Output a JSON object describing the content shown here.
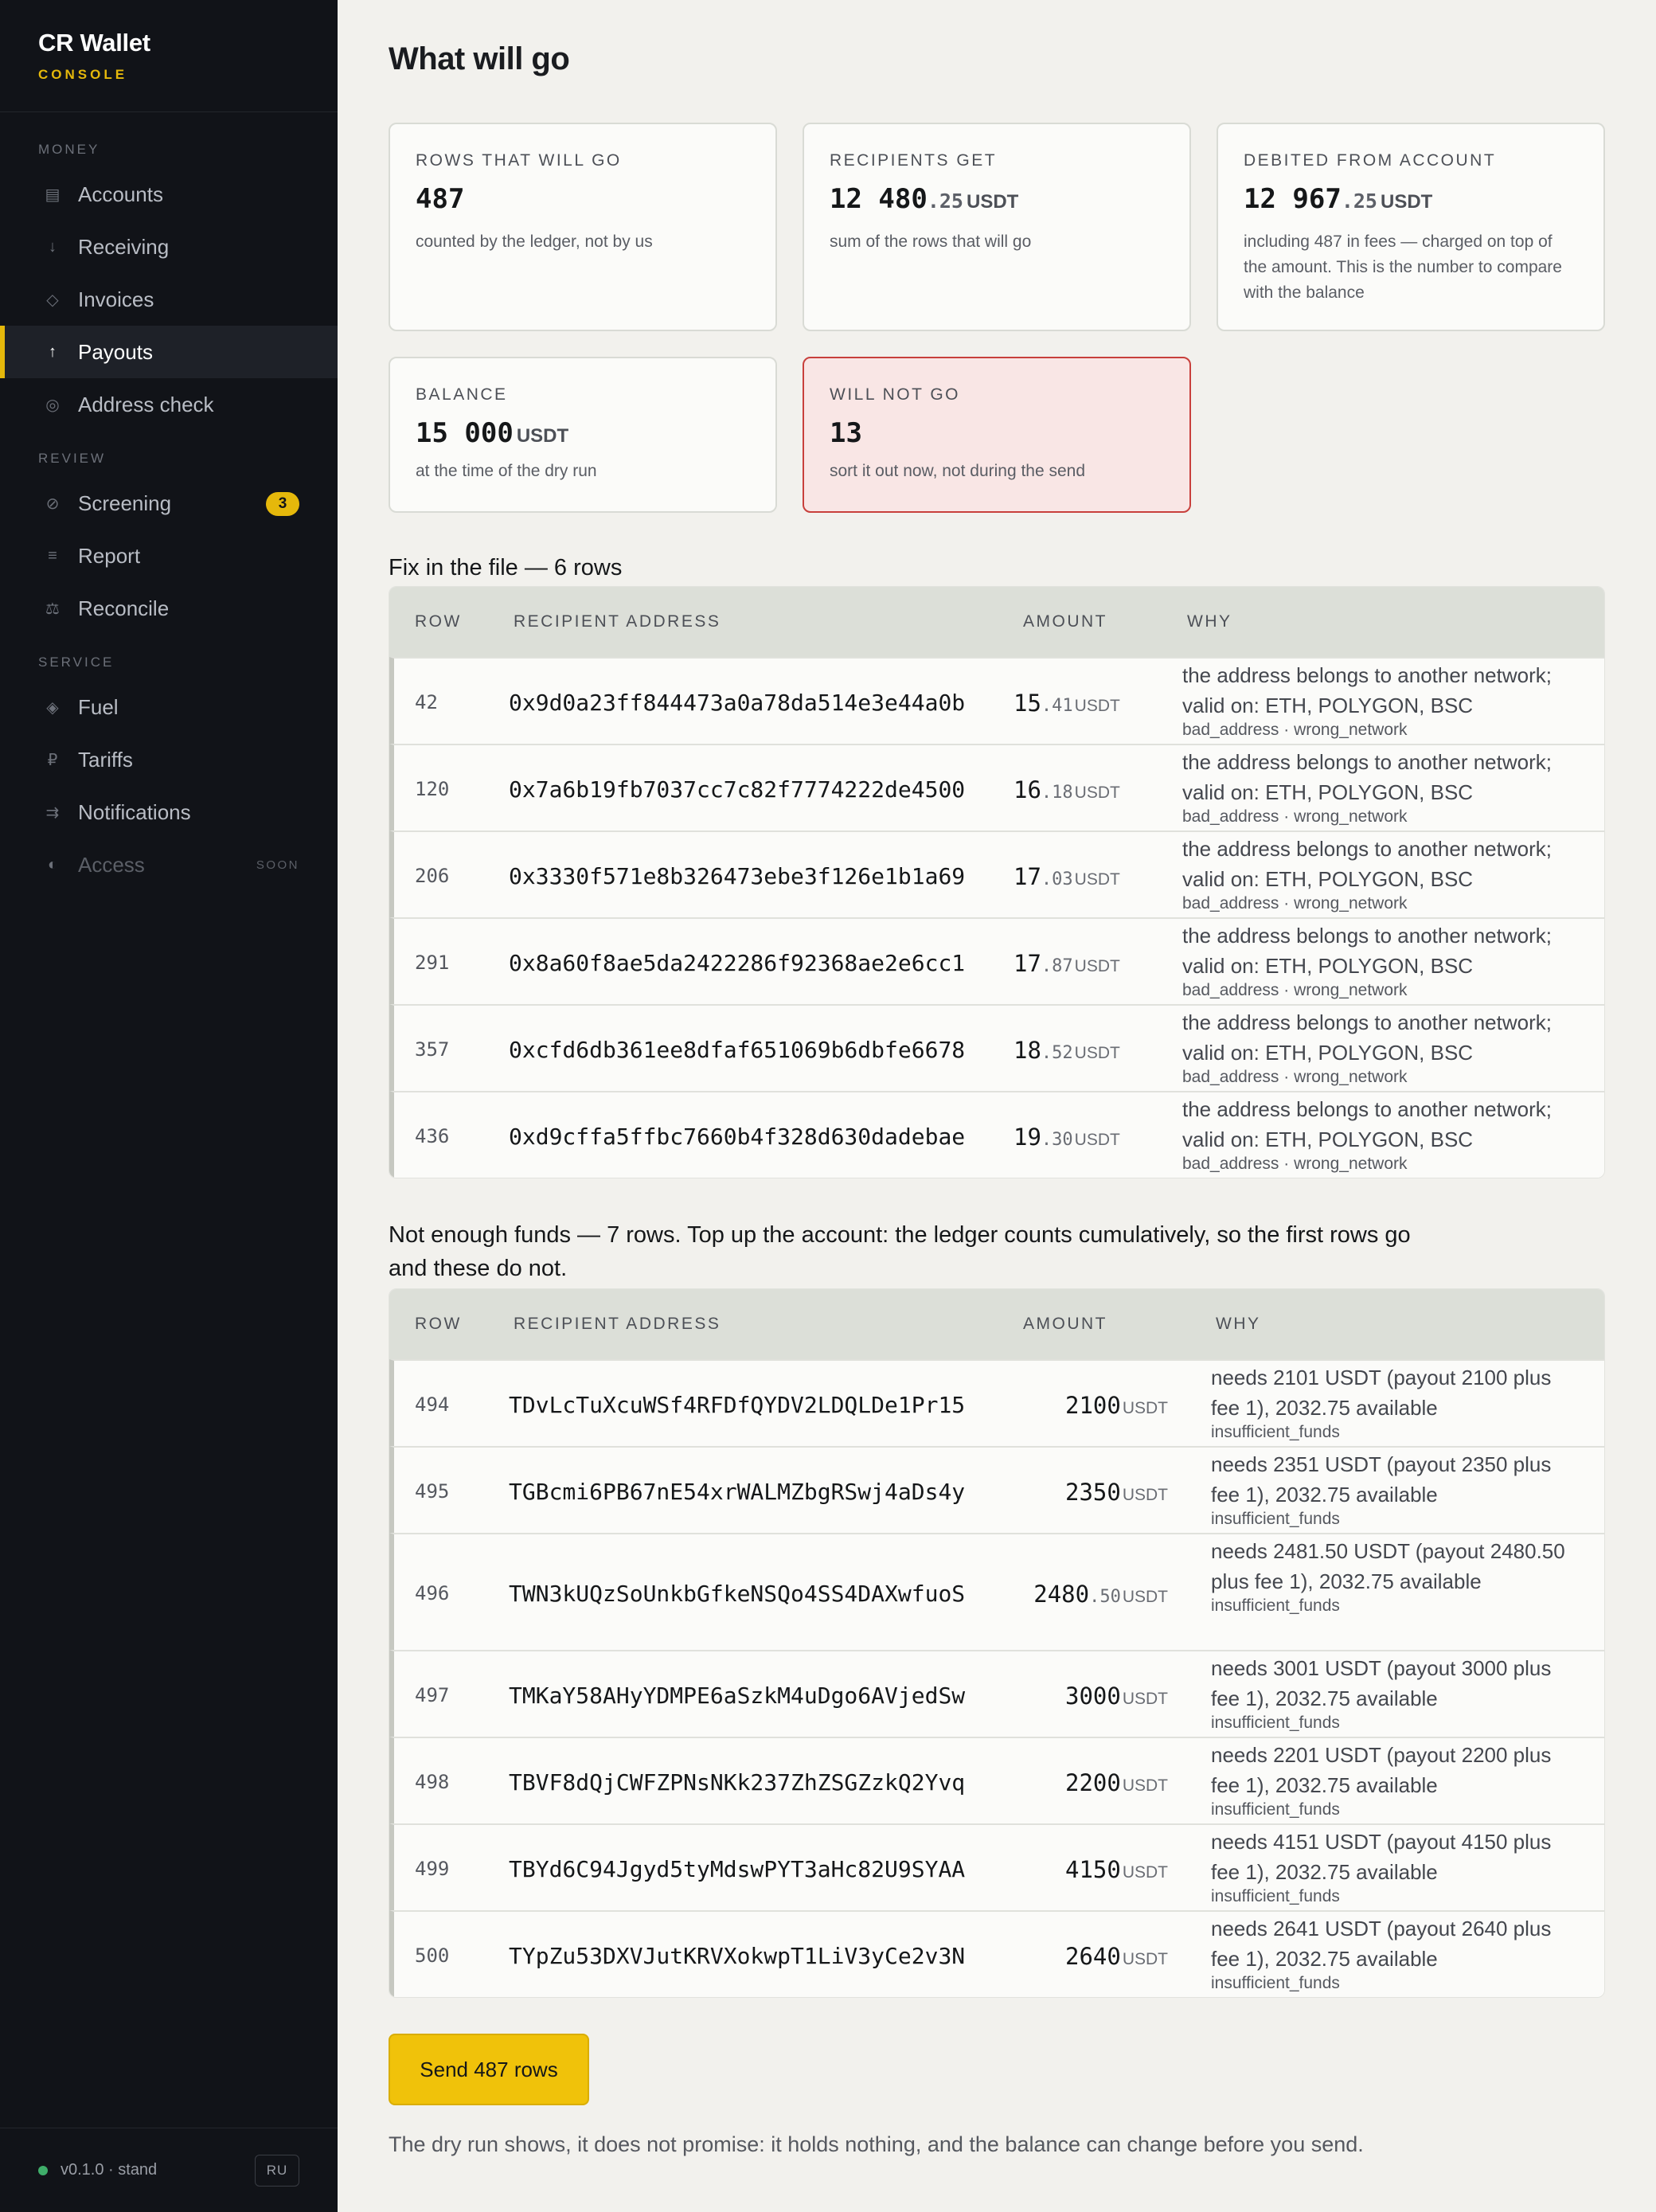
{
  "sidebar": {
    "brand_title": "CR Wallet",
    "brand_sub": "CONSOLE",
    "sections": [
      {
        "label": "MONEY",
        "items": [
          {
            "label": "Accounts",
            "icon": "ledger-icon",
            "glyph": "▤"
          },
          {
            "label": "Receiving",
            "icon": "arrow-down-icon",
            "glyph": "↓"
          },
          {
            "label": "Invoices",
            "icon": "diamond-outline-icon",
            "glyph": "◇"
          },
          {
            "label": "Payouts",
            "icon": "arrow-up-icon",
            "glyph": "↑",
            "active": true
          },
          {
            "label": "Address check",
            "icon": "target-icon",
            "glyph": "◎"
          }
        ]
      },
      {
        "label": "REVIEW",
        "items": [
          {
            "label": "Screening",
            "icon": "prohibited-icon",
            "glyph": "⊘",
            "badge": "3"
          },
          {
            "label": "Report",
            "icon": "list-icon",
            "glyph": "≡"
          },
          {
            "label": "Reconcile",
            "icon": "scales-icon",
            "glyph": "⚖"
          }
        ]
      },
      {
        "label": "SERVICE",
        "items": [
          {
            "label": "Fuel",
            "icon": "fuel-diamond-icon",
            "glyph": "◈"
          },
          {
            "label": "Tariffs",
            "icon": "ruble-icon",
            "glyph": "₽"
          },
          {
            "label": "Notifications",
            "icon": "routing-icon",
            "glyph": "⇉"
          },
          {
            "label": "Access",
            "icon": "half-circle-icon",
            "glyph": "◐",
            "soon": "SOON",
            "disabled": true
          }
        ]
      }
    ],
    "version": "v0.1.0 · stand",
    "lang": "RU",
    "status_color": "#3fae6a"
  },
  "main": {
    "title": "What will go",
    "cards": {
      "rows": {
        "label": "ROWS THAT WILL GO",
        "value": "487",
        "note": "counted by the ledger, not by us"
      },
      "recipients": {
        "label": "RECIPIENTS GET",
        "int": "12 480",
        "frac": ".25",
        "unit": "USDT",
        "note": "sum of the rows that will go"
      },
      "debited": {
        "label": "DEBITED FROM ACCOUNT",
        "int": "12 967",
        "frac": ".25",
        "unit": "USDT",
        "note": "including 487 in fees — charged on top of the amount. This is the number to compare with the balance"
      },
      "balance": {
        "label": "BALANCE",
        "int": "15 000",
        "unit": "USDT",
        "note": "at the time of the dry run"
      },
      "will_not_go": {
        "label": "WILL NOT GO",
        "value": "13",
        "note": "sort it out now, not during the send"
      }
    },
    "fix": {
      "title": "Fix in the file — 6 rows",
      "headers": {
        "row": "ROW",
        "address": "RECIPIENT ADDRESS",
        "amount": "AMOUNT",
        "why": "WHY"
      },
      "rows": [
        {
          "row": "42",
          "address": "0x9d0a23ff844473a0a78da514e3e44a0b",
          "int": "15",
          "frac": ".41",
          "unit": "USDT",
          "why": "the address belongs to another network; valid on: ETH, POLYGON, BSC",
          "code": "bad_address · wrong_network"
        },
        {
          "row": "120",
          "address": "0x7a6b19fb7037cc7c82f7774222de4500",
          "int": "16",
          "frac": ".18",
          "unit": "USDT",
          "why": "the address belongs to another network; valid on: ETH, POLYGON, BSC",
          "code": "bad_address · wrong_network"
        },
        {
          "row": "206",
          "address": "0x3330f571e8b326473ebe3f126e1b1a69",
          "int": "17",
          "frac": ".03",
          "unit": "USDT",
          "why": "the address belongs to another network; valid on: ETH, POLYGON, BSC",
          "code": "bad_address · wrong_network"
        },
        {
          "row": "291",
          "address": "0x8a60f8ae5da2422286f92368ae2e6cc1",
          "int": "17",
          "frac": ".87",
          "unit": "USDT",
          "why": "the address belongs to another network; valid on: ETH, POLYGON, BSC",
          "code": "bad_address · wrong_network"
        },
        {
          "row": "357",
          "address": "0xcfd6db361ee8dfaf651069b6dbfe6678",
          "int": "18",
          "frac": ".52",
          "unit": "USDT",
          "why": "the address belongs to another network; valid on: ETH, POLYGON, BSC",
          "code": "bad_address · wrong_network"
        },
        {
          "row": "436",
          "address": "0xd9cffa5ffbc7660b4f328d630dadebae",
          "int": "19",
          "frac": ".30",
          "unit": "USDT",
          "why": "the address belongs to another network; valid on: ETH, POLYGON, BSC",
          "code": "bad_address · wrong_network"
        }
      ]
    },
    "funds": {
      "title": "Not enough funds — 7 rows. Top up the account: the ledger counts cumulatively, so the first rows go and these do not.",
      "headers": {
        "row": "ROW",
        "address": "RECIPIENT ADDRESS",
        "amount": "AMOUNT",
        "why": "WHY"
      },
      "rows": [
        {
          "row": "494",
          "address": "TDvLcTuXcuWSf4RFDfQYDV2LDQLDe1Pr15",
          "int": "2100",
          "frac": "",
          "unit": "USDT",
          "why": "needs 2101 USDT (payout 2100 plus fee 1), 2032.75 available",
          "code": "insufficient_funds"
        },
        {
          "row": "495",
          "address": "TGBcmi6PB67nE54xrWALMZbgRSwj4aDs4y",
          "int": "2350",
          "frac": "",
          "unit": "USDT",
          "why": "needs 2351 USDT (payout 2350 plus fee 1), 2032.75 available",
          "code": "insufficient_funds"
        },
        {
          "row": "496",
          "address": "TWN3kUQzSoUnkbGfkeNSQo4SS4DAXwfuoS",
          "int": "2480",
          "frac": ".50",
          "unit": "USDT",
          "why": "needs 2481.50 USDT (payout 2480.50 plus fee 1), 2032.75 available",
          "code": "insufficient_funds",
          "tall": true
        },
        {
          "row": "497",
          "address": "TMKaY58AHyYDMPE6aSzkM4uDgo6AVjedSw",
          "int": "3000",
          "frac": "",
          "unit": "USDT",
          "why": "needs 3001 USDT (payout 3000 plus fee 1), 2032.75 available",
          "code": "insufficient_funds"
        },
        {
          "row": "498",
          "address": "TBVF8dQjCWFZPNsNKk237ZhZSGZzkQ2Yvq",
          "int": "2200",
          "frac": "",
          "unit": "USDT",
          "why": "needs 2201 USDT (payout 2200 plus fee 1), 2032.75 available",
          "code": "insufficient_funds"
        },
        {
          "row": "499",
          "address": "TBYd6C94Jgyd5tyMdswPYT3aHc82U9SYAA",
          "int": "4150",
          "frac": "",
          "unit": "USDT",
          "why": "needs 4151 USDT (payout 4150 plus fee 1), 2032.75 available",
          "code": "insufficient_funds"
        },
        {
          "row": "500",
          "address": "TYpZu53DXVJutKRVXokwpT1LiV3yCe2v3N",
          "int": "2640",
          "frac": "",
          "unit": "USDT",
          "why": "needs 2641 USDT (payout 2640 plus fee 1), 2032.75 available",
          "code": "insufficient_funds"
        }
      ]
    },
    "send_button": "Send 487 rows",
    "disclaimer": "The dry run shows, it does not promise: it holds nothing, and the balance can change before you send.",
    "colors": {
      "accent": "#f0c20a",
      "warn_border": "#c8403c",
      "warn_bg": "#f9e6e5",
      "sidebar_bg": "#111318"
    }
  }
}
